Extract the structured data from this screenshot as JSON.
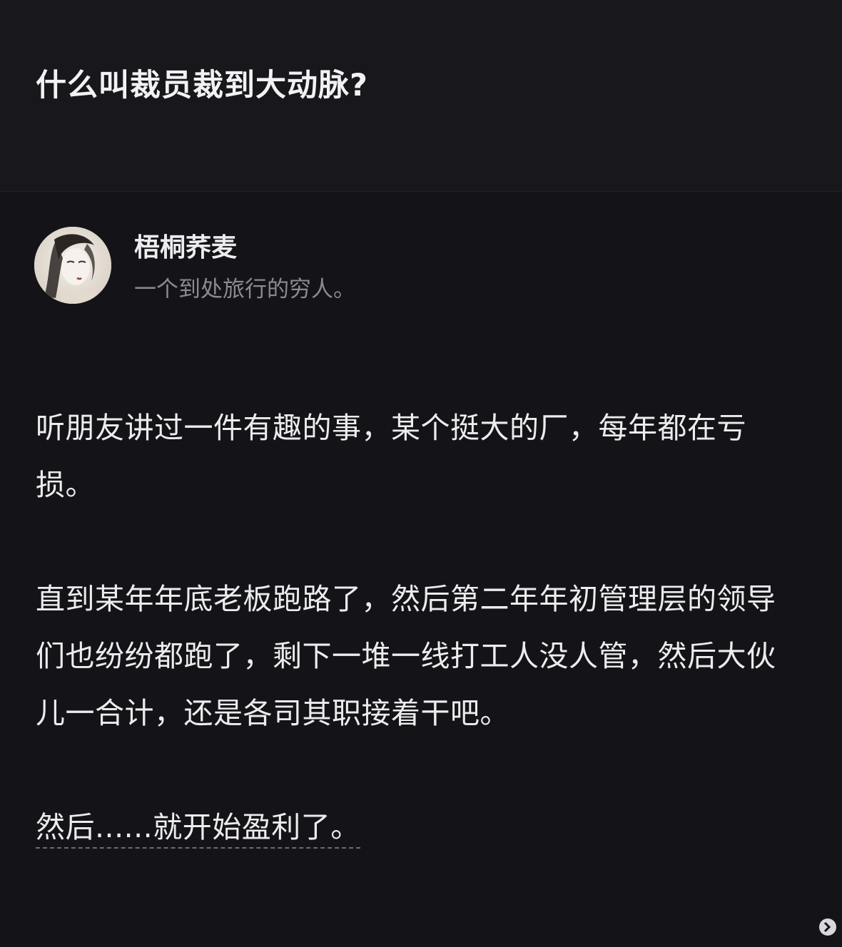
{
  "question": {
    "title": "什么叫裁员裁到大动脉?"
  },
  "author": {
    "name": "梧桐荞麦",
    "bio": "一个到处旅行的穷人。",
    "avatar_icon": "avatar-portrait-icon"
  },
  "answer": {
    "paragraphs": [
      "听朋友讲过一件有趣的事，某个挺大的厂，每年都在亏损。",
      "直到某年年底老板跑路了，然后第二年年初管理层的领导们也纷纷都跑了，剩下一堆一线打工人没人管，然后大伙儿一合计，还是各司其职接着干吧。",
      "然后......就开始盈利了。"
    ]
  },
  "colors": {
    "background": "#141418",
    "header_background": "#18181c",
    "text_primary": "#ececee",
    "text_secondary": "#8a8a90"
  }
}
